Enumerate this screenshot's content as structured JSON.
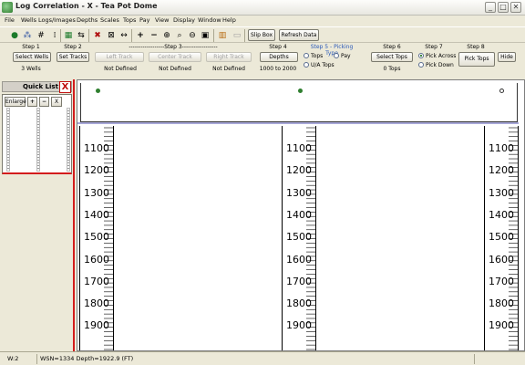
{
  "window": {
    "title": "Log Correlation - X - Tea Pot Dome",
    "controls": [
      "_",
      "□",
      "✕"
    ]
  },
  "menu": [
    "File",
    "Wells",
    "Logs/Images",
    "Depths",
    "Scales",
    "Tops",
    "Pay",
    "View",
    "Display",
    "Window",
    "Help"
  ],
  "toolbar": {
    "icons": [
      "globe-icon",
      "wells-icon",
      "grid-icon",
      "track-icon",
      "table-icon",
      "swap-icon",
      "delete-icon",
      "cross-icon",
      "expand-icon",
      "plus-icon",
      "minus-icon",
      "zoom-in-icon",
      "zoom-icon",
      "zoom-out-icon",
      "image-icon",
      "color-tracks-icon",
      "tracks-disabled-icon"
    ],
    "slip_box": "Slip Box",
    "refresh_data": "Refresh Data"
  },
  "steps": {
    "step1": {
      "label": "Step 1",
      "button": "Select Wells",
      "value": "3 Wells"
    },
    "step2": {
      "label": "Step 2",
      "button": "Set Tracks",
      "value": "Not Defined"
    },
    "step3": {
      "label": "------------------Step 3------------------",
      "buttons": [
        "Left Track",
        "Center Track",
        "Right Track"
      ],
      "values": [
        "Not Defined",
        "Not Defined"
      ]
    },
    "step4": {
      "label": "Step 4",
      "button": "Depths",
      "value": "1000 to 2000"
    },
    "step5": {
      "label": "Step 5 - Picking Type",
      "options": [
        "Tops",
        "Pay",
        "U/A Tops"
      ],
      "selected": "Tops"
    },
    "step6": {
      "label": "Step 6",
      "button": "Select Tops",
      "value": "0 Tops"
    },
    "step7": {
      "label": "Step 7",
      "options": [
        "Pick Across",
        "Pick Down"
      ],
      "selected": "Pick Across"
    },
    "step8": {
      "label": "Step 8",
      "button": "Pick Tops",
      "hide": "Hide"
    }
  },
  "quick_list": {
    "title": "Quick List",
    "close": "X",
    "enlarge": "Enlarge",
    "plus": "+",
    "minus": "−",
    "cross": "X"
  },
  "tracks": {
    "depth_labels": [
      "1100",
      "1200",
      "1300",
      "1400",
      "1500",
      "1600",
      "1700",
      "1800",
      "1900"
    ],
    "count": 3
  },
  "status": {
    "window_no": "W:2",
    "info": "WSN=1334 Depth=1922.9 (FT)"
  },
  "colors": {
    "accent_red": "#d31c1c",
    "pick_green": "#2f7f2f",
    "step_blue": "#2a59b8"
  }
}
